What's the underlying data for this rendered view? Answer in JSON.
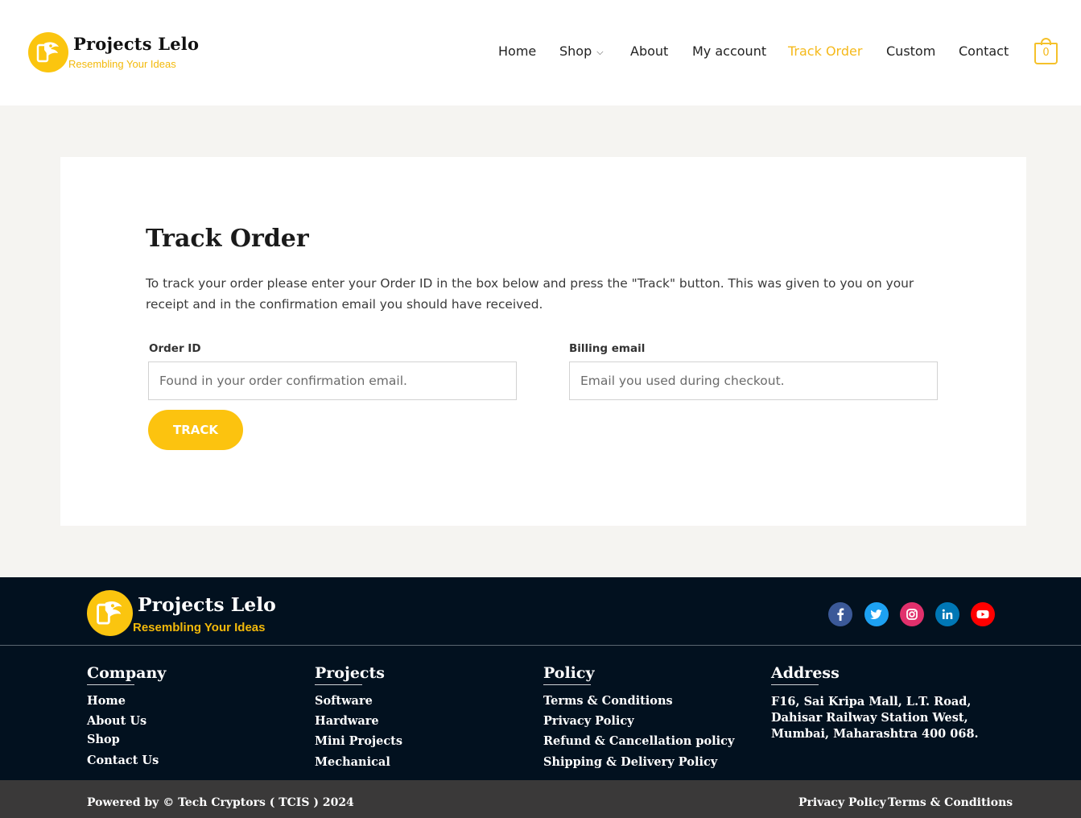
{
  "brand": {
    "name": "Projects Lelo",
    "tagline": "Resembling Your Ideas",
    "accent_color": "#fcc30f",
    "footer_bg": "#02111f"
  },
  "nav": {
    "items": [
      {
        "label": "Home"
      },
      {
        "label": "Shop",
        "has_dropdown": true,
        "chevron": "⌵"
      },
      {
        "label": "About"
      },
      {
        "label": "My account"
      },
      {
        "label": "Track Order",
        "active": true
      },
      {
        "label": "Custom"
      },
      {
        "label": "Contact"
      }
    ],
    "cart_count": "0"
  },
  "main": {
    "title": "Track Order",
    "intro": "To track your order please enter your Order ID in the box below and press the \"Track\" button. This was given to you on your receipt and in the confirmation email you should have received.",
    "order_id_label": "Order ID",
    "order_id_placeholder": "Found in your order confirmation email.",
    "billing_email_label": "Billing email",
    "billing_email_placeholder": "Email you used during checkout.",
    "track_button": "TRACK"
  },
  "footer": {
    "social": [
      {
        "name": "facebook-icon",
        "color": "#3b5998"
      },
      {
        "name": "twitter-icon",
        "color": "#1da1f2"
      },
      {
        "name": "instagram-icon",
        "color": "#e1306c"
      },
      {
        "name": "linkedin-icon",
        "color": "#0077b5"
      },
      {
        "name": "youtube-icon",
        "color": "#ff0000"
      }
    ],
    "columns": [
      {
        "title": "Company",
        "links": [
          "Home",
          "About Us",
          "Shop",
          "Contact Us"
        ]
      },
      {
        "title": "Projects",
        "links": [
          "Software",
          "Hardware",
          "Mini Projects",
          "Mechanical"
        ]
      },
      {
        "title": "Policy",
        "links": [
          "Terms & Conditions",
          "Privacy Policy",
          "Refund & Cancellation policy",
          "Shipping & Delivery Policy"
        ]
      },
      {
        "title": "Address",
        "text": "F16, Sai Kripa Mall, L.T. Road, Dahisar Railway Station West, Mumbai, Maharashtra 400 068."
      }
    ],
    "copyright": "Powered by © Tech Cryptors ( TCIS ) 2024",
    "bottom_links": [
      "Privacy Policy",
      "Terms & Conditions"
    ]
  }
}
